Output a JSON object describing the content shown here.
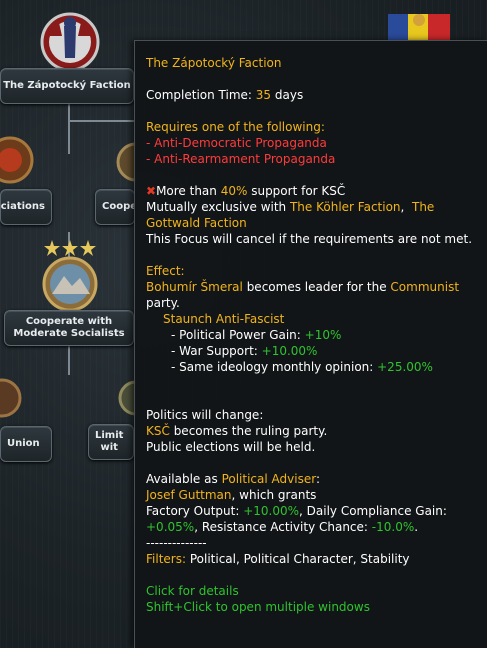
{
  "tree": {
    "nodes": {
      "zapotocky": "The Zápotocký Faction",
      "associations": "ociations",
      "coope": "Coope",
      "cooperate_socialists": "Cooperate with\nModerate Socialists",
      "union": "Union",
      "limit": "Limit\nwit"
    }
  },
  "tooltip": {
    "title": "The Zápotocký Faction",
    "completion_label": "Completion Time: ",
    "completion_value": "35",
    "completion_unit": " days",
    "requires_header": "Requires one of the following:",
    "requires_items": [
      "- Anti-Democratic Propaganda",
      "- Anti-Rearmament Propaganda"
    ],
    "support_pre": "More than ",
    "support_value": "40%",
    "support_post": " support for KSČ",
    "exclusive_pre": "Mutually exclusive with ",
    "exclusive_a": "The Köhler Faction",
    "exclusive_sep": ",  ",
    "exclusive_b": "The Gottwald Faction",
    "cancel_note": "This Focus will cancel if the requirements are not met.",
    "effect_header": "Effect:",
    "leader_name": "Bohumír Šmeral",
    "leader_mid": " becomes leader for the ",
    "leader_party": "Communist",
    "leader_end": "party.",
    "trait_name": "Staunch Anti-Fascist",
    "trait_lines": [
      {
        "label": "- Political Power Gain: ",
        "value": "+10%"
      },
      {
        "label": "- War Support: ",
        "value": "+10.00%"
      },
      {
        "label": "- Same ideology monthly opinion: ",
        "value": "+25.00%"
      }
    ],
    "politics_change": "Politics will change:",
    "ruling_party": "KSČ",
    "ruling_text": " becomes the ruling party.",
    "elections": "Public elections will be held.",
    "adviser_pre": "Available as ",
    "adviser_role": "Political Adviser",
    "adviser_post": ":",
    "adviser_name": "Josef Guttman",
    "adviser_grants": ", which grants",
    "mod1_label": "Factory Output: ",
    "mod1_value": "+10.00%",
    "mod2_label": ", Daily Compliance Gain:",
    "mod2_value": "+0.05%",
    "mod3_label": ", Resistance Activity Chance: ",
    "mod3_value": "-10.0%",
    "mod_end": ".",
    "separator": "--------------",
    "filters_label": "Filters:",
    "filters_value": " Political, Political Character, Stability",
    "click_details": "Click for details",
    "shift_click": "Shift+Click to open multiple windows"
  },
  "colors": {
    "highlight": "#f2b41b",
    "negative": "#ff3b3b",
    "positive": "#2fc32f",
    "text": "#ffffff"
  }
}
